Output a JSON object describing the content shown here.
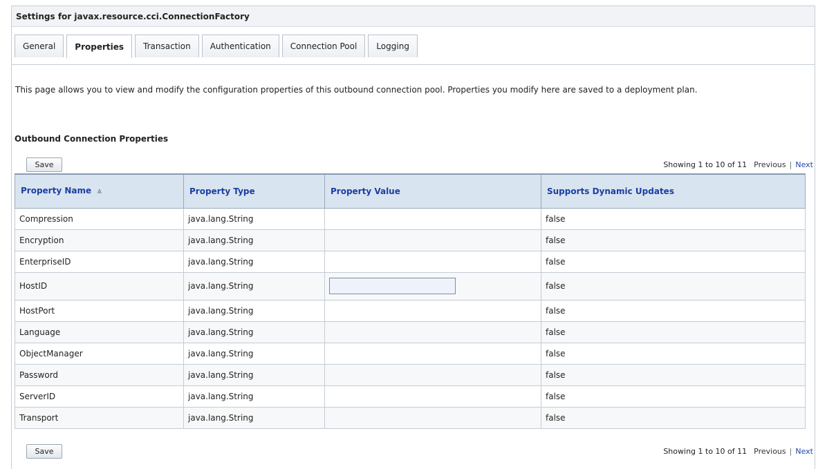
{
  "header": {
    "title": "Settings for javax.resource.cci.ConnectionFactory"
  },
  "tabs": [
    {
      "label": "General",
      "active": false
    },
    {
      "label": "Properties",
      "active": true
    },
    {
      "label": "Transaction",
      "active": false
    },
    {
      "label": "Authentication",
      "active": false
    },
    {
      "label": "Connection Pool",
      "active": false
    },
    {
      "label": "Logging",
      "active": false
    }
  ],
  "description": "This page allows you to view and modify the configuration properties of this outbound connection pool. Properties you modify here are saved to a deployment plan.",
  "section": {
    "title": "Outbound Connection Properties"
  },
  "toolbar": {
    "save_label": "Save"
  },
  "pager": {
    "showing": "Showing 1 to 10 of 11",
    "previous": "Previous",
    "separator": "|",
    "next": "Next"
  },
  "table": {
    "columns": [
      "Property Name",
      "Property Type",
      "Property Value",
      "Supports Dynamic Updates"
    ],
    "sort_icon": "⩓",
    "rows": [
      {
        "name": "Compression",
        "type": "java.lang.String",
        "value": "",
        "dynamic": "false"
      },
      {
        "name": "Encryption",
        "type": "java.lang.String",
        "value": "",
        "dynamic": "false"
      },
      {
        "name": "EnterpriseID",
        "type": "java.lang.String",
        "value": "",
        "dynamic": "false"
      },
      {
        "name": "HostID",
        "type": "java.lang.String",
        "value": "",
        "dynamic": "false"
      },
      {
        "name": "HostPort",
        "type": "java.lang.String",
        "value": "",
        "dynamic": "false"
      },
      {
        "name": "Language",
        "type": "java.lang.String",
        "value": "",
        "dynamic": "false"
      },
      {
        "name": "ObjectManager",
        "type": "java.lang.String",
        "value": "",
        "dynamic": "false"
      },
      {
        "name": "Password",
        "type": "java.lang.String",
        "value": "",
        "dynamic": "false"
      },
      {
        "name": "ServerID",
        "type": "java.lang.String",
        "value": "",
        "dynamic": "false"
      },
      {
        "name": "Transport",
        "type": "java.lang.String",
        "value": "",
        "dynamic": "false"
      }
    ]
  },
  "colors": {
    "header_link": "#1b3fa0",
    "table_header_bg": "#d9e4f1",
    "next_link": "#1f46a8"
  }
}
